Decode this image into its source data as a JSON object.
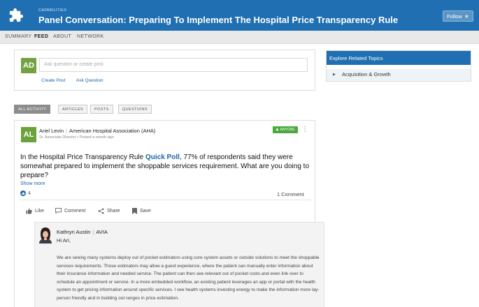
{
  "header": {
    "kicker": "CAPABILITIES",
    "title": "Panel Conversation: Preparing To Implement The Hospital Price Transparency Rule",
    "follow_label": "Follow",
    "brand_color": "#1f6fb2"
  },
  "nav": {
    "tabs": [
      "SUMMARY",
      "FEED",
      "ABOUT",
      "NETWORK"
    ],
    "active": "FEED"
  },
  "composer": {
    "avatar_initials": "AD",
    "placeholder": "Ask question or create post",
    "create_post": "Create Post",
    "ask_question": "Ask Question"
  },
  "filters": [
    "ALL ACTIVITY",
    "ARTICLES",
    "POSTS",
    "QUESTIONS"
  ],
  "post": {
    "avatar_initials": "AL",
    "author": "Ariel Levin",
    "organization": "American Hospital Association (AHA)",
    "byline": "Sr. Associate Director • Posted a month ago",
    "visibility": "ANYONE",
    "text_before": "In the Hospital Price Transparency Rule ",
    "poll_link": "Quick Poll",
    "text_after": ", 77% of respondents said they were somewhat prepared to implement the shoppable services requirement. What are you doing to prepare?",
    "show_more": "Show more",
    "likes": "4",
    "comments_count": "1 Comment",
    "actions": {
      "like": "Like",
      "comment": "Comment",
      "share": "Share",
      "save": "Save"
    }
  },
  "comment": {
    "author": "Kathryn Austin",
    "organization": "AVIA",
    "greeting": "Hi Ari,",
    "body": "We are seeing many systems deploy out of pocket estimators using core system assets or outside solutions to meet the shoppable services requirements. Those estimators may allow a guest experience, where the patient can manually enter information about their insurance information and needed service. The patient can then see relevant out of pocket costs and even link over to schedule an appointment or service. In a more embedded workflow, an existing patient leverages an app or portal with the health system to get pricing information around specific services. I see health systems investing energy to make the information more lay-person friendly and in building out ranges in price estimation."
  },
  "sidebar": {
    "heading": "Explore Related Topics",
    "items": [
      "Acquisition & Growth"
    ]
  }
}
